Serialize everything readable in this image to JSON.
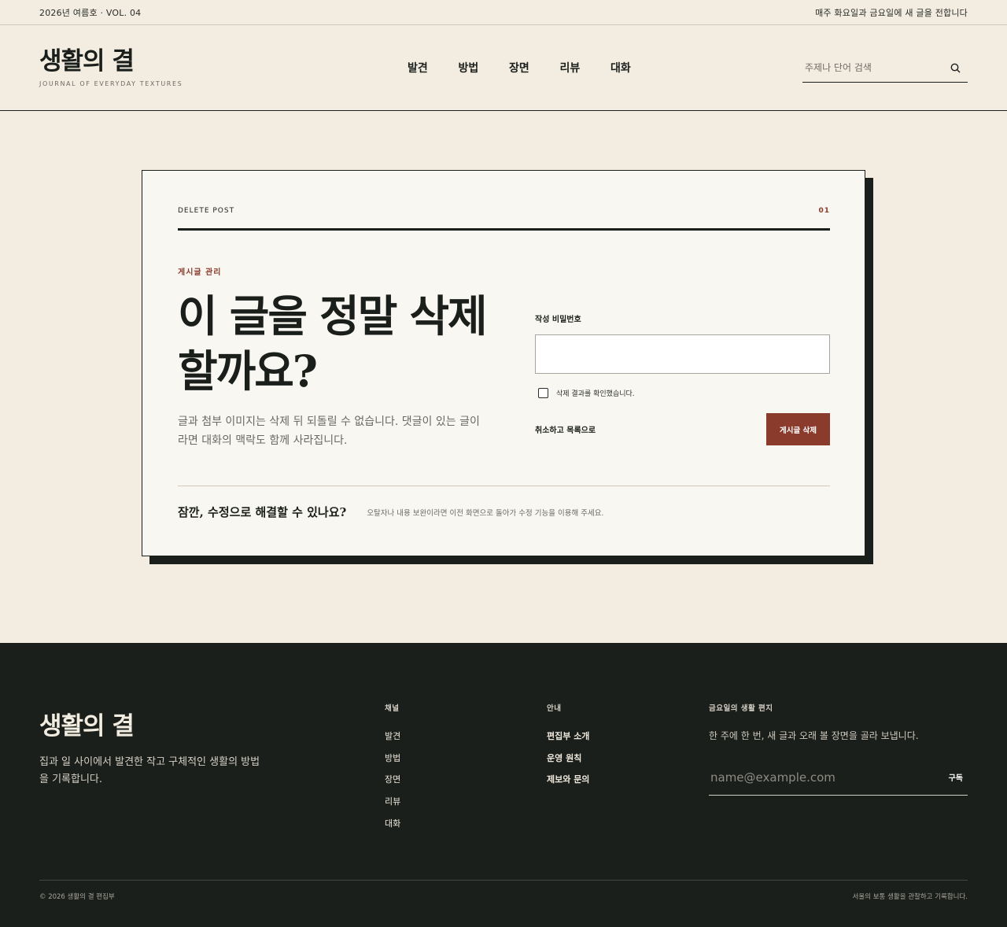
{
  "topbar": {
    "issue": "2026년 여름호 · VOL. 04",
    "schedule": "매주 화요일과 금요일에 새 글을 전합니다"
  },
  "header": {
    "brand_name": "생활의 결",
    "brand_sub": "JOURNAL OF EVERYDAY TEXTURES",
    "nav": [
      "발견",
      "방법",
      "장면",
      "리뷰",
      "대화"
    ],
    "search_placeholder": "주제나 단어 검색",
    "search_icon": "search-icon"
  },
  "card": {
    "label": "DELETE POST",
    "number": "01",
    "kicker": "게시글 관리",
    "title": "이 글을 정말 삭제할까요?",
    "description": "글과 첨부 이미지는 삭제 뒤 되돌릴 수 없습니다. 댓글이 있는 글이라면 대화의 맥락도 함께 사라집니다.",
    "password_label": "작성 비밀번호",
    "password_value": "",
    "confirm_label": "삭제 결과를 확인했습니다.",
    "confirm_checked": false,
    "cancel_label": "취소하고 목록으로",
    "delete_label": "게시글 삭제",
    "foot_question": "잠깐, 수정으로 해결할 수 있나요?",
    "foot_note": "오탈자나 내용 보완이라면 이전 화면으로 돌아가 수정 기능을 이용해 주세요."
  },
  "footer": {
    "brand_name": "생활의 결",
    "description": "집과 일 사이에서 발견한 작고 구체적인 생활의 방법을 기록합니다.",
    "channels": {
      "heading": "채널",
      "items": [
        "발견",
        "방법",
        "장면",
        "리뷰",
        "대화"
      ]
    },
    "info": {
      "heading": "안내",
      "items": [
        "편집부 소개",
        "운영 원칙",
        "제보와 문의"
      ]
    },
    "newsletter": {
      "heading": "금요일의 생활 편지",
      "text": "한 주에 한 번, 새 글과 오래 볼 장면을 골라 보냅니다.",
      "email_placeholder": "name@example.com",
      "subscribe_label": "구독"
    },
    "copyright": "© 2026 생활의 결 편집부",
    "tagline": "서울의 보통 생활을 관찰하고 기록합니다."
  },
  "colors": {
    "background": "#f2ece1",
    "ink": "#1b1f1b",
    "accent": "#8a3b2c",
    "card": "#f9f7f2"
  }
}
